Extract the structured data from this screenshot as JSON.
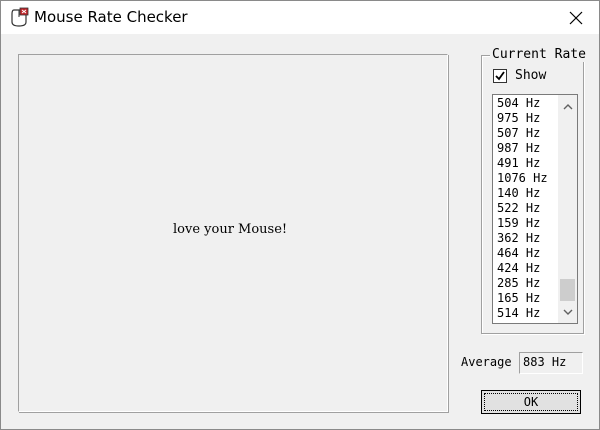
{
  "window": {
    "title": "Mouse Rate Checker",
    "icons": {
      "app": "mouse-app-icon",
      "close": "close-icon"
    }
  },
  "canvas": {
    "message": "love your Mouse!"
  },
  "rate_panel": {
    "group_label": "Current Rate",
    "show_checkbox": {
      "label": "Show",
      "checked": true
    },
    "rates": [
      "504 Hz",
      "975 Hz",
      "507 Hz",
      "987 Hz",
      "491 Hz",
      "1076 Hz",
      "140 Hz",
      "522 Hz",
      "159 Hz",
      "362 Hz",
      "464 Hz",
      "424 Hz",
      "285 Hz",
      "165 Hz",
      "514 Hz"
    ],
    "scroll_icons": {
      "up": "chevron-up-icon",
      "down": "chevron-down-icon"
    }
  },
  "average": {
    "label": "Average",
    "value": "883 Hz"
  },
  "ok_button": {
    "label": "OK"
  },
  "colors": {
    "window_bg": "#f0f0f0",
    "titlebar_bg": "#ffffff",
    "listbox_bg": "#ffffff"
  }
}
